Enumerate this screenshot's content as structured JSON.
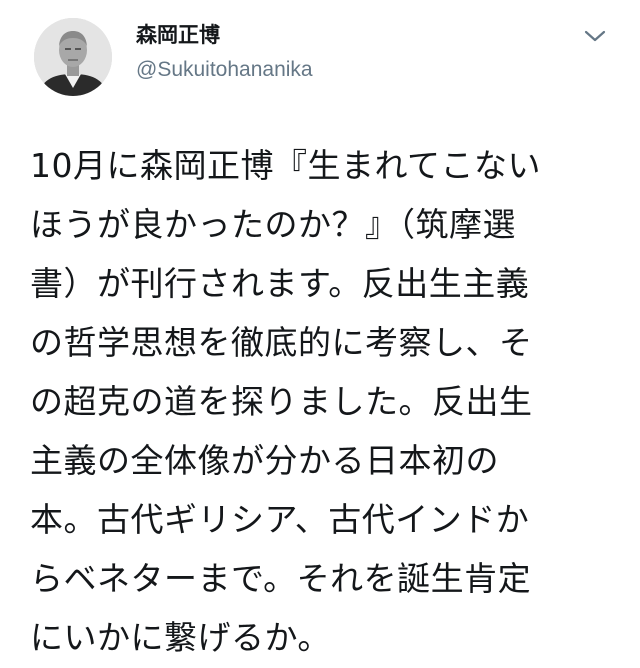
{
  "tweet": {
    "author": {
      "display_name": "森岡正博",
      "handle": "@Sukuitohananika"
    },
    "icons": {
      "more": "chevron-down-icon"
    },
    "colors": {
      "text": "#14171a",
      "secondary": "#657786"
    },
    "text_lines": [
      "10月に森岡正博『生まれてこない",
      "ほうが良かったのか？』（筑摩選",
      "書）が刊行されます。反出生主義",
      "の哲学思想を徹底的に考察し、そ",
      "の超克の道を探りました。反出生",
      "主義の全体像が分かる日本初の",
      "本。古代ギリシア、古代インドか",
      "らベネターまで。それを誕生肯定",
      "にいかに繋げるか。"
    ]
  }
}
